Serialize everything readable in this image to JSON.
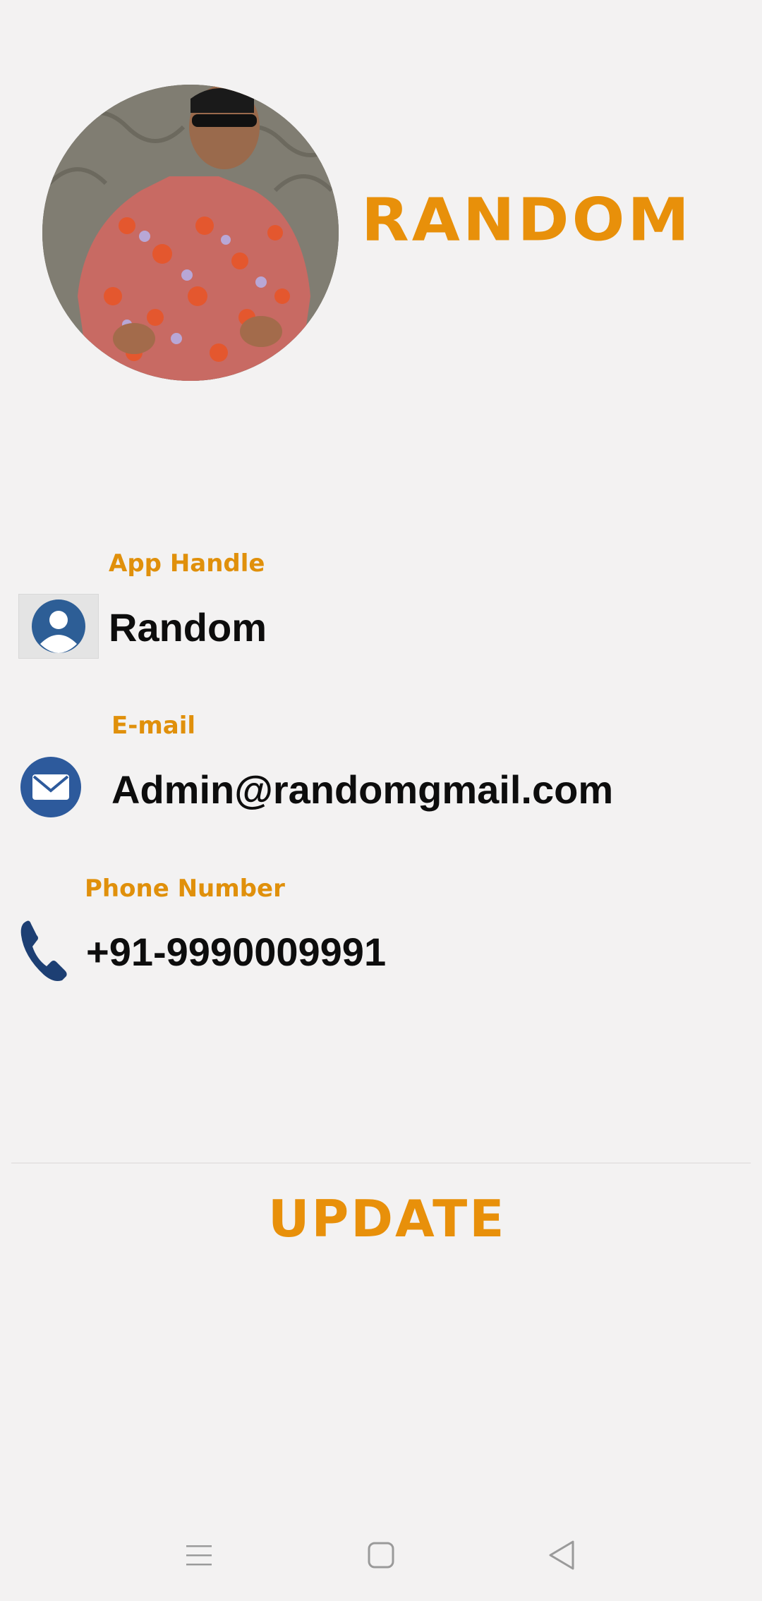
{
  "profile": {
    "name": "RANDOM",
    "avatar_icon": "profile-photo"
  },
  "fields": {
    "app_handle": {
      "label": "App Handle",
      "value": "Random",
      "icon": "user-avatar-icon"
    },
    "email": {
      "label": "E-mail",
      "value": "Admin@randomgmail.com",
      "icon": "envelope-icon"
    },
    "phone": {
      "label": "Phone Number",
      "value": "+91-9990009991",
      "icon": "phone-icon"
    }
  },
  "actions": {
    "update_label": "UPDATE"
  },
  "nav_bar": {
    "icons": [
      "menu-icon",
      "home-square-icon",
      "back-triangle-icon"
    ]
  },
  "colors": {
    "background": "#f3f2f2",
    "accent": "#e8900a",
    "label": "#e0900b",
    "text": "#0d0d0d",
    "icon_blue": "#2b5aa0"
  }
}
